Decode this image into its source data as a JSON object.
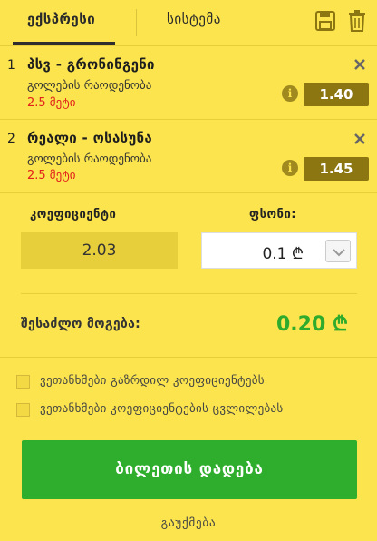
{
  "tabs": {
    "express": "ექსპრესი",
    "system": "სისტემა"
  },
  "bets": [
    {
      "num": "1",
      "title": "პსვ - გრონინგენი",
      "market": "გოლების რაოდენობა",
      "pick": "2.5 მეტი",
      "odds": "1.40"
    },
    {
      "num": "2",
      "title": "რეალი - ოსასუნა",
      "market": "გოლების რაოდენობა",
      "pick": "2.5 მეტი",
      "odds": "1.45"
    }
  ],
  "icons": {
    "info": "i",
    "close": "close-icon",
    "save": "save-icon",
    "trash": "trash-icon",
    "chevron": "chevron-down-icon"
  },
  "stake": {
    "coef_label": "კოეფიციენტი",
    "coef_value": "2.03",
    "money_label": "ფსონი:",
    "money_value": "0.1 ₾"
  },
  "win": {
    "label": "შესაძლო მოგება:",
    "value": "0.20 ₾"
  },
  "options": {
    "accept_higher": "ვეთანხმები გაზრდილ კოეფიციენტებს",
    "accept_changes": "ვეთანხმები კოეფიციენტების ცვლილებას"
  },
  "actions": {
    "place": "ბილეთის დადება",
    "clear": "გაუქმება"
  },
  "colors": {
    "background": "#fbe44d",
    "odds": "#8c7612",
    "pick": "#e0201a",
    "win": "#2eab2c",
    "button": "#2eae2c"
  }
}
